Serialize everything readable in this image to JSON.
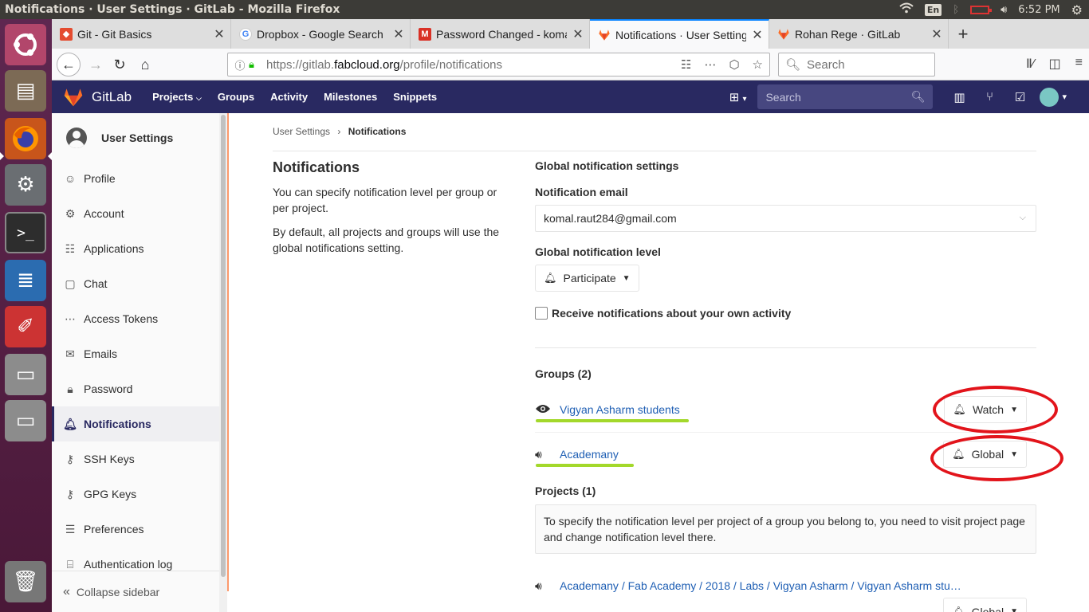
{
  "os": {
    "window_title": "Notifications · User Settings · GitLab - Mozilla Firefox",
    "keyboard": "En",
    "clock": "6:52 PM"
  },
  "browser": {
    "tabs": [
      {
        "label": "Git - Git Basics",
        "icon": "git-icon",
        "color": "#e44c30",
        "active": false
      },
      {
        "label": "Dropbox - Google Search",
        "icon": "google-icon",
        "color": "#4285f4",
        "active": false
      },
      {
        "label": "Password Changed - komal",
        "icon": "gmail-icon",
        "color": "#d93025",
        "active": false
      },
      {
        "label": "Notifications · User Settings",
        "icon": "gitlab-icon",
        "color": "#fc6d26",
        "active": true
      },
      {
        "label": "Rohan Rege · GitLab",
        "icon": "gitlab-icon",
        "color": "#fc6d26",
        "active": false
      }
    ],
    "url_prefix": "https://gitlab.",
    "url_domain": "fabcloud.org",
    "url_path": "/profile/notifications",
    "search_placeholder": "Search"
  },
  "gitlab": {
    "brand": "GitLab",
    "nav": {
      "projects": "Projects",
      "groups": "Groups",
      "activity": "Activity",
      "milestones": "Milestones",
      "snippets": "Snippets"
    },
    "search_placeholder": "Search"
  },
  "sidebar": {
    "title": "User Settings",
    "items": {
      "profile": "Profile",
      "account": "Account",
      "applications": "Applications",
      "chat": "Chat",
      "access_tokens": "Access Tokens",
      "emails": "Emails",
      "password": "Password",
      "notifications": "Notifications",
      "ssh_keys": "SSH Keys",
      "gpg_keys": "GPG Keys",
      "preferences": "Preferences",
      "auth_log": "Authentication log"
    },
    "collapse": "Collapse sidebar"
  },
  "breadcrumb": {
    "parent": "User Settings",
    "current": "Notifications"
  },
  "left": {
    "title": "Notifications",
    "p1": "You can specify notification level per group or per project.",
    "p2": "By default, all projects and groups will use the global notifications setting."
  },
  "settings": {
    "global_heading": "Global notification settings",
    "email_label": "Notification email",
    "email_value": "komal.raut284@gmail.com",
    "level_label": "Global notification level",
    "level_value": "Participate",
    "own_activity": "Receive notifications about your own activity",
    "own_activity_checked": false
  },
  "groups": {
    "heading": "Groups (2)",
    "rows": [
      {
        "name": "Vigyan Asharm students",
        "icon": "eye-icon",
        "level": "Watch"
      },
      {
        "name": "Academany",
        "icon": "speaker-icon",
        "level": "Global"
      }
    ]
  },
  "projects": {
    "heading": "Projects (1)",
    "note": "To specify the notification level per project of a group you belong to, you need to visit project page and change notification level there.",
    "rows": [
      {
        "name": "Academany / Fab Academy / 2018 / Labs / Vigyan Asharm / Vigyan Asharm students",
        "icon": "speaker-icon",
        "level": "Global"
      }
    ]
  },
  "colors": {
    "header": "#292961",
    "accent_orange": "#fc9a6d",
    "link": "#1f5fb4",
    "highlight": "#a3d82b",
    "annotation": "#e2141b"
  }
}
